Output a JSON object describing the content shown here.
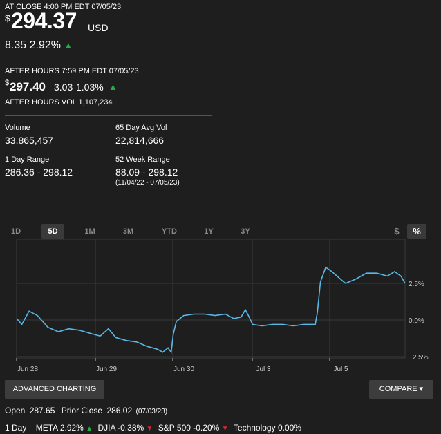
{
  "close": {
    "label": "AT CLOSE 4:00 PM EDT 07/05/23",
    "currency_symbol": "$",
    "price": "294.37",
    "currency": "USD",
    "change": "8.35",
    "change_pct": "2.92%"
  },
  "after_hours": {
    "label": "AFTER HOURS 7:59 PM EDT 07/05/23",
    "currency_symbol": "$",
    "price": "297.40",
    "change": "3.03",
    "change_pct": "1.03%",
    "volume": "AFTER HOURS VOL 1,107,234"
  },
  "stats": {
    "volume_label": "Volume",
    "volume": "33,865,457",
    "avg_vol_label": "65 Day Avg Vol",
    "avg_vol": "22,814,666",
    "day_range_label": "1 Day Range",
    "day_range": "286.36 - 298.12",
    "week52_label": "52 Week Range",
    "week52": "88.09 - 298.12",
    "week52_dates": "(11/04/22 - 07/05/23)"
  },
  "tabs": [
    "1D",
    "5D",
    "1M",
    "3M",
    "YTD",
    "1Y",
    "3Y"
  ],
  "active_tab": "5D",
  "toggle": {
    "dollar": "$",
    "percent": "%"
  },
  "chart_data": {
    "type": "line",
    "x_ticks": [
      "Jun 28",
      "Jun 29",
      "Jun 30",
      "Jul 3",
      "Jul 5"
    ],
    "y_ticks": [
      "2.5%",
      "0.0%",
      "−2.5%"
    ],
    "ylim": [
      -2.5,
      2.5
    ],
    "grid": true,
    "line_color": "#5ab8e6",
    "points": [
      [
        0,
        0.1
      ],
      [
        0.5,
        -0.3
      ],
      [
        1.2,
        0.6
      ],
      [
        2.0,
        0.3
      ],
      [
        3.0,
        -0.5
      ],
      [
        4.0,
        -0.8
      ],
      [
        5.0,
        -0.6
      ],
      [
        6.0,
        -0.7
      ],
      [
        7.0,
        -0.9
      ],
      [
        8.0,
        -1.1
      ],
      [
        8.8,
        -0.6
      ],
      [
        9.5,
        -1.2
      ],
      [
        10.5,
        -1.4
      ],
      [
        11.5,
        -1.5
      ],
      [
        12.5,
        -1.8
      ],
      [
        13.5,
        -2.0
      ],
      [
        14.0,
        -2.2
      ],
      [
        14.5,
        -1.9
      ],
      [
        14.8,
        -2.2
      ],
      [
        15.0,
        -1.0
      ],
      [
        15.3,
        -0.1
      ],
      [
        16.0,
        0.3
      ],
      [
        17.0,
        0.4
      ],
      [
        18.0,
        0.4
      ],
      [
        19.0,
        0.3
      ],
      [
        20.0,
        0.4
      ],
      [
        20.8,
        0.1
      ],
      [
        21.5,
        0.2
      ],
      [
        21.9,
        0.7
      ],
      [
        22.2,
        0.3
      ],
      [
        22.6,
        -0.3
      ],
      [
        23.5,
        -0.4
      ],
      [
        24.5,
        -0.3
      ],
      [
        25.5,
        -0.3
      ],
      [
        26.5,
        -0.4
      ],
      [
        27.5,
        -0.3
      ],
      [
        28.3,
        -0.3
      ],
      [
        28.6,
        -0.3
      ],
      [
        28.8,
        0.5
      ],
      [
        29.1,
        2.6
      ],
      [
        29.6,
        3.6
      ],
      [
        30.2,
        3.3
      ],
      [
        31.0,
        2.8
      ],
      [
        31.5,
        2.5
      ],
      [
        32.5,
        2.8
      ],
      [
        33.5,
        3.2
      ],
      [
        34.5,
        3.2
      ],
      [
        35.5,
        3.0
      ],
      [
        36.2,
        3.3
      ],
      [
        36.8,
        3.0
      ],
      [
        37.2,
        2.5
      ]
    ]
  },
  "buttons": {
    "advanced": "ADVANCED CHARTING",
    "compare": "COMPARE ▾"
  },
  "open_label": "Open",
  "open": "287.65",
  "prior_label": "Prior Close",
  "prior": "286.02",
  "prior_date": "(07/03/23)",
  "compare_bar": {
    "label": "1 Day",
    "items": [
      {
        "name": "META",
        "value": "2.92%",
        "dir": "up"
      },
      {
        "name": "DJIA",
        "value": "-0.38%",
        "dir": "down"
      },
      {
        "name": "S&P 500",
        "value": "-0.20%",
        "dir": "down"
      },
      {
        "name": "Technology",
        "value": "0.00%",
        "dir": "none"
      }
    ]
  }
}
